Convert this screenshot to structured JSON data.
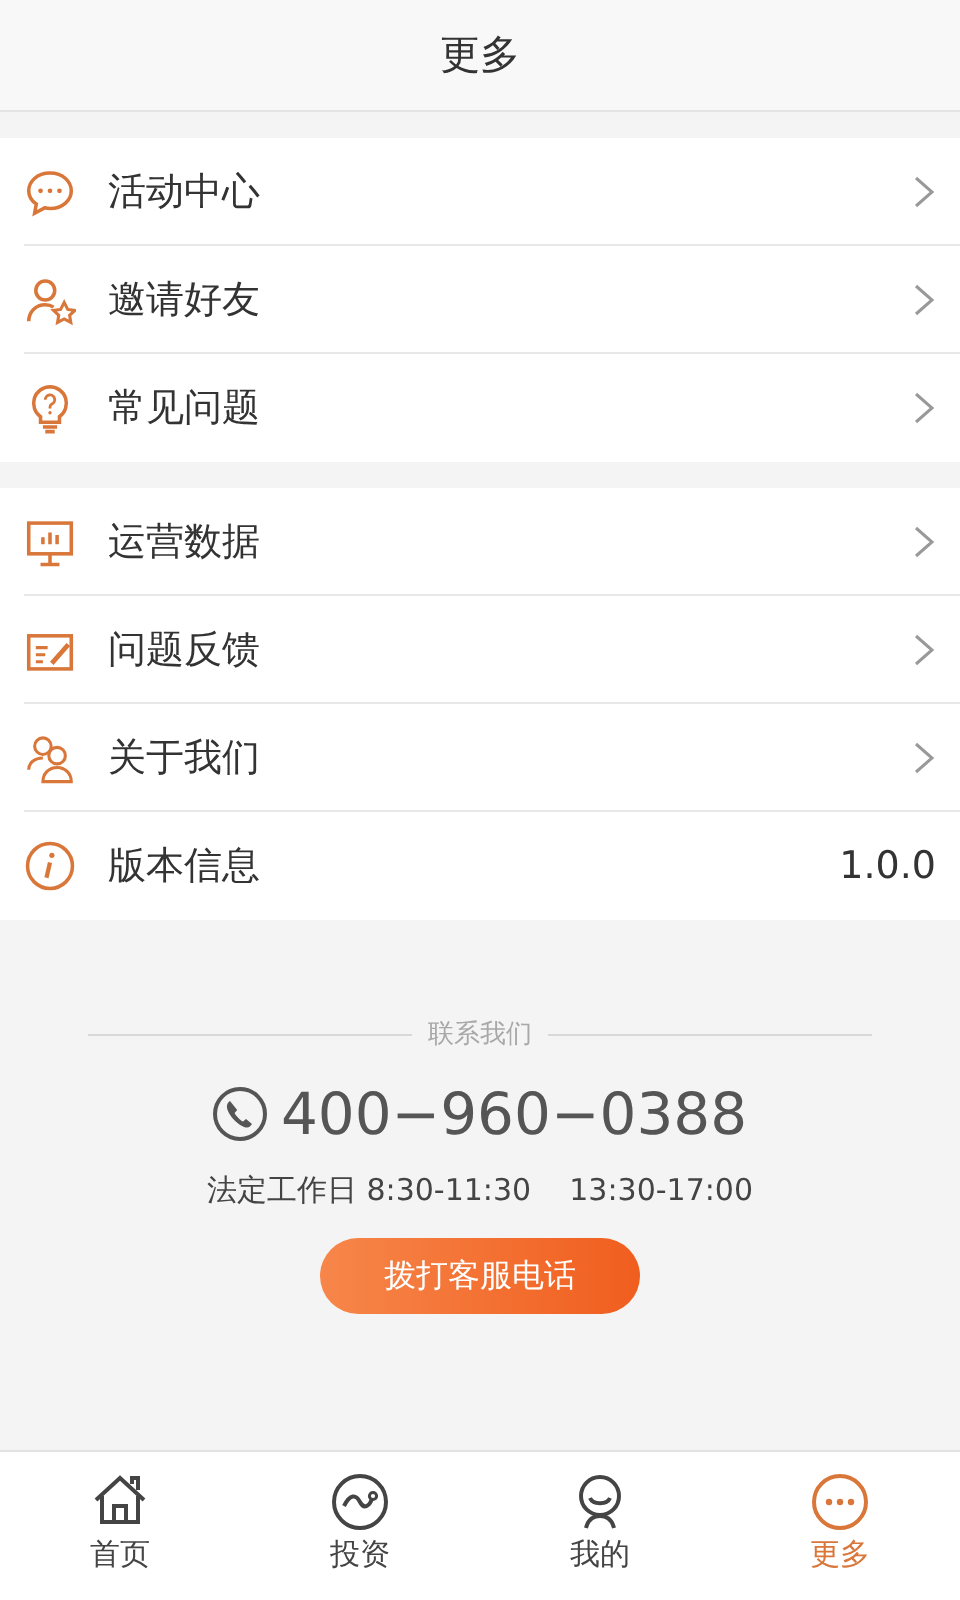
{
  "header": {
    "title": "更多"
  },
  "groups": [
    {
      "items": [
        {
          "label": "活动中心",
          "kind": "link"
        },
        {
          "label": "邀请好友",
          "kind": "link"
        },
        {
          "label": "常见问题",
          "kind": "link"
        }
      ]
    },
    {
      "items": [
        {
          "label": "运营数据",
          "kind": "link"
        },
        {
          "label": "问题反馈",
          "kind": "link"
        },
        {
          "label": "关于我们",
          "kind": "link"
        },
        {
          "label": "版本信息",
          "kind": "value",
          "value": "1.0.0"
        }
      ]
    }
  ],
  "contact": {
    "heading": "联系我们",
    "phone": "400−960−0388",
    "hours": "法定工作日 8:30-11:30    13:30-17:00",
    "button": "拨打客服电话"
  },
  "tabs": [
    {
      "label": "首页",
      "selected": false
    },
    {
      "label": "投资",
      "selected": false
    },
    {
      "label": "我的",
      "selected": false
    },
    {
      "label": "更多",
      "selected": true
    }
  ]
}
